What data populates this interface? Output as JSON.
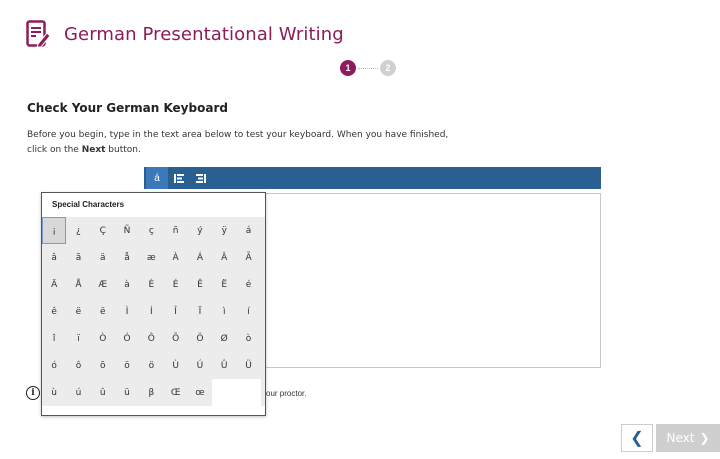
{
  "header": {
    "title": "German Presentational Writing",
    "icon": "pencil-document-icon",
    "accent_color": "#8e1b5a"
  },
  "stepper": {
    "steps": [
      "1",
      "2"
    ],
    "active_step": 1
  },
  "section": {
    "title": "Check Your German Keyboard",
    "instructions_part1": "Before you begin, type in the text area below to test your keyboard. When you have finished, click on the ",
    "instructions_bold": "Next",
    "instructions_part2": " button."
  },
  "toolbar": {
    "items": [
      {
        "label": "á",
        "icon": "special-characters-icon",
        "active": true
      },
      {
        "label": "",
        "icon": "align-left-icon"
      },
      {
        "label": "",
        "icon": "align-right-icon"
      }
    ],
    "color": "#2a5f91"
  },
  "info": {
    "visible_text": "our proctor."
  },
  "special_chars": {
    "title": "Special Characters",
    "chars": [
      "¡",
      "¿",
      "Ç",
      "Ñ",
      "ç",
      "ñ",
      "ý",
      "ÿ",
      "á",
      "â",
      "ã",
      "ä",
      "å",
      "æ",
      "À",
      "Á",
      "Â",
      "Ã",
      "Ä",
      "Å",
      "Æ",
      "à",
      "È",
      "É",
      "Ê",
      "Ë",
      "é",
      "ê",
      "ë",
      "ë",
      "Ì",
      "Í",
      "Î",
      "Ï",
      "ì",
      "í",
      "î",
      "ï",
      "Ò",
      "Ó",
      "Ô",
      "Õ",
      "Ö",
      "Ø",
      "ò",
      "ó",
      "ô",
      "õ",
      "ö",
      "ö",
      "Ù",
      "Ú",
      "Û",
      "Ü",
      "ù",
      "ú",
      "û",
      "ü",
      "β",
      "Œ",
      "œ"
    ]
  },
  "nav": {
    "prev_icon": "chevron-left-icon",
    "next_label": "Next",
    "next_icon": "chevron-right-icon"
  }
}
